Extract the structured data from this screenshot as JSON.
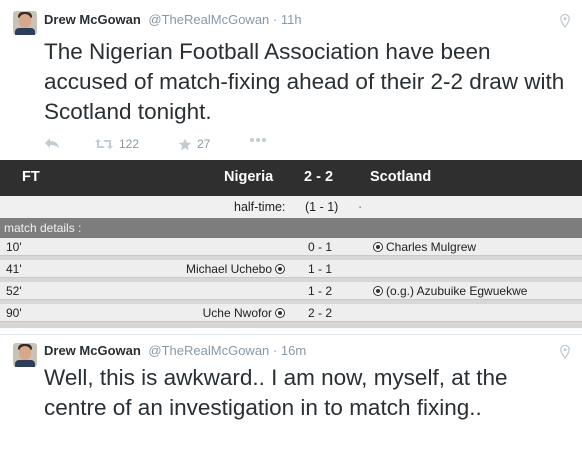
{
  "tweets": [
    {
      "name": "Drew McGowan",
      "handle": "@TheRealMcGowan",
      "separator": "·",
      "time": "11h",
      "text": "The Nigerian Football Association have been accused of match-fixing ahead of their 2-2 draw with Scotland tonight.",
      "retweets": "122",
      "favorites": "27",
      "icons": [
        "reply-icon",
        "retweet-icon",
        "favorite-icon",
        "more-icon",
        "location-pin-icon"
      ]
    },
    {
      "name": "Drew McGowan",
      "handle": "@TheRealMcGowan",
      "separator": "·",
      "time": "16m",
      "text": "Well, this is awkward.. I am now, myself, at the centre of an investigation in to match fixing..",
      "icons": [
        "location-pin-icon"
      ]
    }
  ],
  "match": {
    "status": "FT",
    "home_team": "Nigeria",
    "score": "2 - 2",
    "away_team": "Scotland",
    "halftime_label": "half-time:",
    "halftime_score": "(1 - 1)",
    "halftime_dot": "·",
    "details_label": "match details :",
    "events": [
      {
        "minute": "10'",
        "home": "",
        "score": "0 - 1",
        "away": "Charles Mulgrew"
      },
      {
        "minute": "41'",
        "home": "Michael Uchebo",
        "score": "1 - 1",
        "away": ""
      },
      {
        "minute": "52'",
        "home": "",
        "score": "1 - 2",
        "away": "(o.g.) Azubuike Egwuekwe"
      },
      {
        "minute": "90'",
        "home": "Uche Nwofor",
        "score": "2 - 2",
        "away": ""
      }
    ],
    "colors": {
      "header_bg": "#2f2f2f",
      "details_bar": "#7d7d7d",
      "row_bg": "#eeeeee"
    }
  }
}
